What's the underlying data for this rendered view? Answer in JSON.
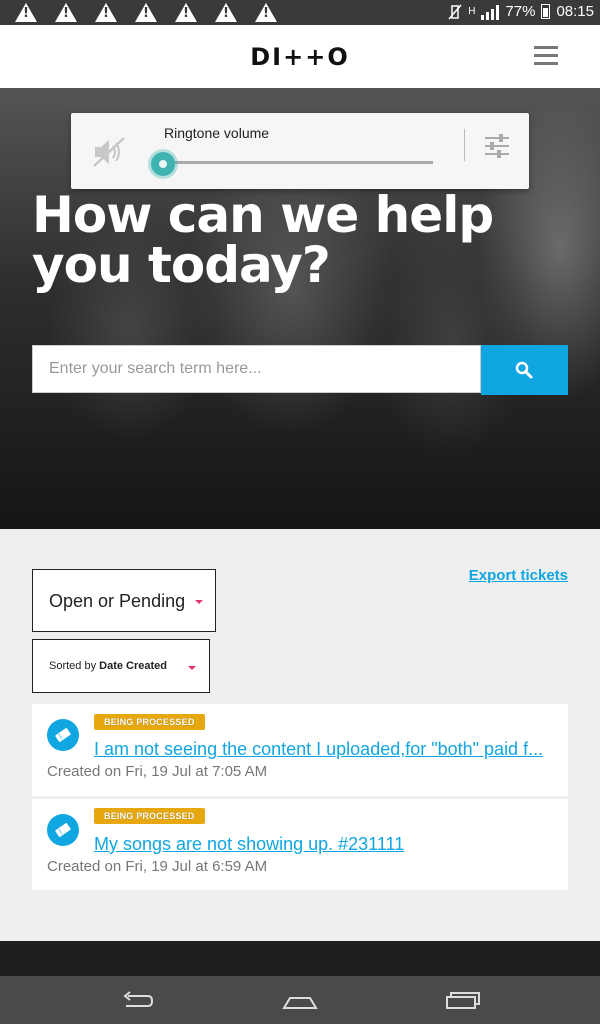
{
  "statusbar": {
    "notifications": [
      "warning-icon",
      "warning-icon",
      "warning-icon",
      "warning-icon",
      "warning-icon",
      "warning-icon",
      "warning-icon"
    ],
    "network": "H",
    "battery": "77%",
    "time": "08:15"
  },
  "header": {
    "logo": "DI++O"
  },
  "volume_dialog": {
    "label": "Ringtone volume",
    "level": 0.0
  },
  "hero": {
    "title": "How can we help you today?",
    "search_placeholder": "Enter your search term here..."
  },
  "tickets": {
    "export_label": "Export tickets",
    "status_filter": "Open or Pending",
    "sort_prefix": "Sorted by",
    "sort_value": "Date Created",
    "items": [
      {
        "badge": "BEING PROCESSED",
        "title": "I am not seeing the content I uploaded,for \"both\" paid f...",
        "date": "Created on Fri, 19 Jul at 7:05 AM"
      },
      {
        "badge": "BEING PROCESSED",
        "title": "My songs are not showing up. #231111",
        "date": "Created on Fri, 19 Jul at 6:59 AM"
      }
    ]
  },
  "colors": {
    "accent": "#10a6e1",
    "badge": "#e6a80e",
    "slider": "#3eb3b0",
    "caret": "#e4356a"
  }
}
